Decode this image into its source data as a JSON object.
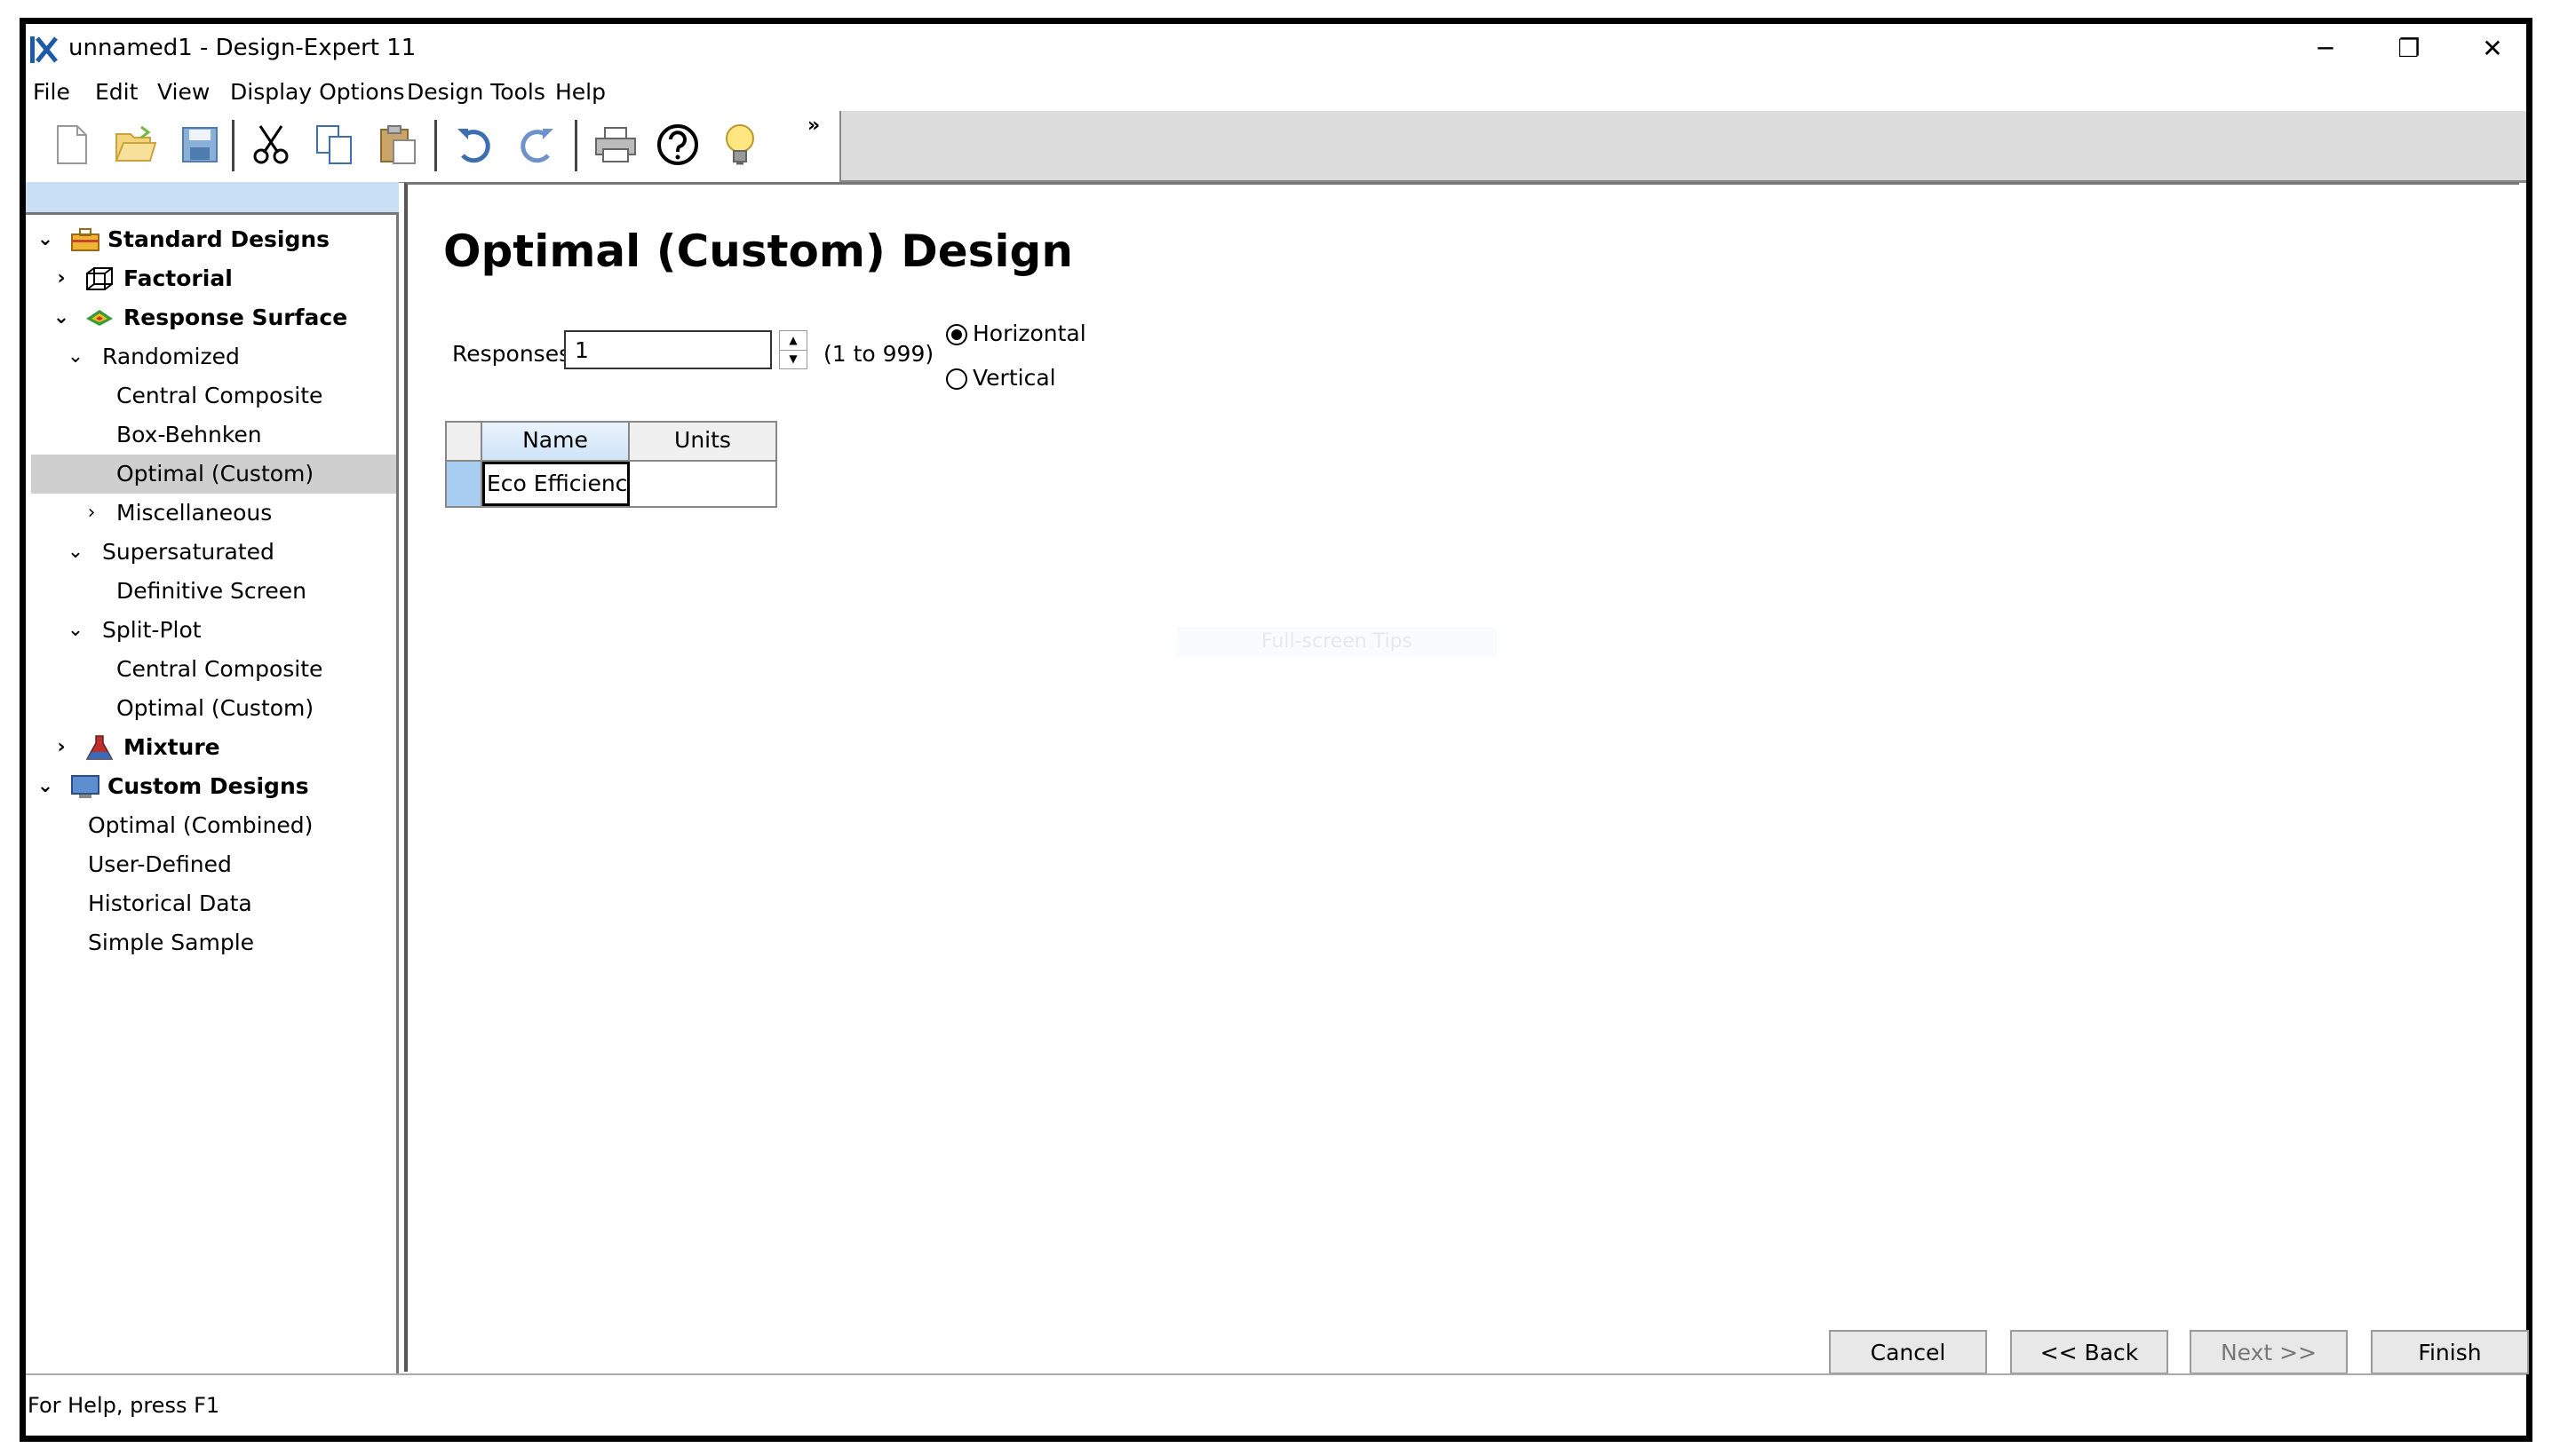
{
  "window": {
    "title": "unnamed1 - Design-Expert 11",
    "controls": {
      "minimize": "─",
      "restore": "❐",
      "close": "✕"
    }
  },
  "menu": [
    "File",
    "Edit",
    "View",
    "Display Options",
    "Design Tools",
    "Help"
  ],
  "toolbar": {
    "buttons": [
      "new-icon",
      "open-icon",
      "save-icon",
      "cut-icon",
      "copy-icon",
      "paste-icon",
      "undo-icon",
      "redo-icon",
      "print-icon",
      "help-icon",
      "tip-bulb-icon"
    ],
    "overflow": "»"
  },
  "tree": {
    "standard_designs": "Standard Designs",
    "factorial": "Factorial",
    "response_surface": "Response Surface",
    "randomized": "Randomized",
    "central_composite": "Central Composite",
    "box_behnken": "Box-Behnken",
    "optimal_custom": "Optimal (Custom)",
    "miscellaneous": "Miscellaneous",
    "supersaturated": "Supersaturated",
    "definitive_screen": "Definitive Screen",
    "split_plot": "Split-Plot",
    "sp_central_composite": "Central Composite",
    "sp_optimal_custom": "Optimal (Custom)",
    "mixture": "Mixture",
    "custom_designs": "Custom Designs",
    "optimal_combined": "Optimal (Combined)",
    "user_defined": "User-Defined",
    "historical_data": "Historical Data",
    "simple_sample": "Simple Sample",
    "expanded_chevron": "⌄",
    "collapsed_chevron": "›"
  },
  "main": {
    "title": "Optimal (Custom) Design",
    "responses_label": "Responses:",
    "responses_value": "1",
    "range": "(1 to 999)",
    "orientation": {
      "horizontal": "Horizontal",
      "vertical": "Vertical",
      "selected": "Horizontal"
    },
    "grid": {
      "columns": [
        "Name",
        "Units"
      ],
      "rows": [
        {
          "name": "Eco Efficiency",
          "units": ""
        }
      ]
    },
    "tip": "Full-screen Tips"
  },
  "buttons": {
    "cancel": "Cancel",
    "back": "<< Back",
    "next": "Next >>",
    "finish": "Finish"
  },
  "status": "For Help, press F1",
  "colors": {
    "selection": "#cfcfcf",
    "header_blue": "#cfe4f8",
    "row_marker": "#a9cdf0"
  }
}
